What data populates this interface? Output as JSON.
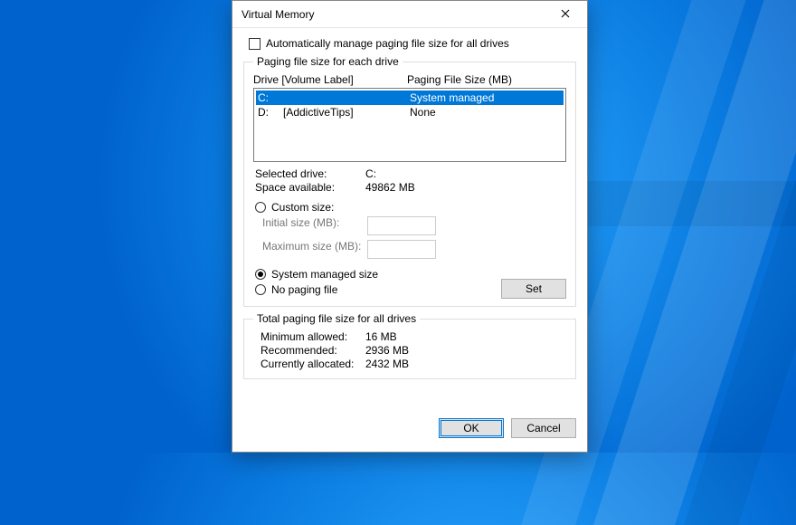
{
  "dialog": {
    "title": "Virtual Memory",
    "auto_manage_label": "Automatically manage paging file size for all drives",
    "auto_manage_checked": false,
    "group1": {
      "legend": "Paging file size for each drive",
      "header_drive": "Drive  [Volume Label]",
      "header_size": "Paging File Size (MB)",
      "drives": [
        {
          "letter": "C:",
          "label": "",
          "size": "System managed",
          "selected": true
        },
        {
          "letter": "D:",
          "label": "[AddictiveTips]",
          "size": "None",
          "selected": false
        }
      ],
      "selected_drive_label": "Selected drive:",
      "selected_drive_value": "C:",
      "space_available_label": "Space available:",
      "space_available_value": "49862 MB",
      "radio_custom": "Custom size:",
      "initial_label": "Initial size (MB):",
      "max_label": "Maximum size (MB):",
      "radio_system": "System managed size",
      "radio_none": "No paging file",
      "radio_selected": "system",
      "set_btn": "Set"
    },
    "group2": {
      "legend": "Total paging file size for all drives",
      "min_label": "Minimum allowed:",
      "min_value": "16 MB",
      "rec_label": "Recommended:",
      "rec_value": "2936 MB",
      "cur_label": "Currently allocated:",
      "cur_value": "2432 MB"
    },
    "ok_btn": "OK",
    "cancel_btn": "Cancel"
  }
}
